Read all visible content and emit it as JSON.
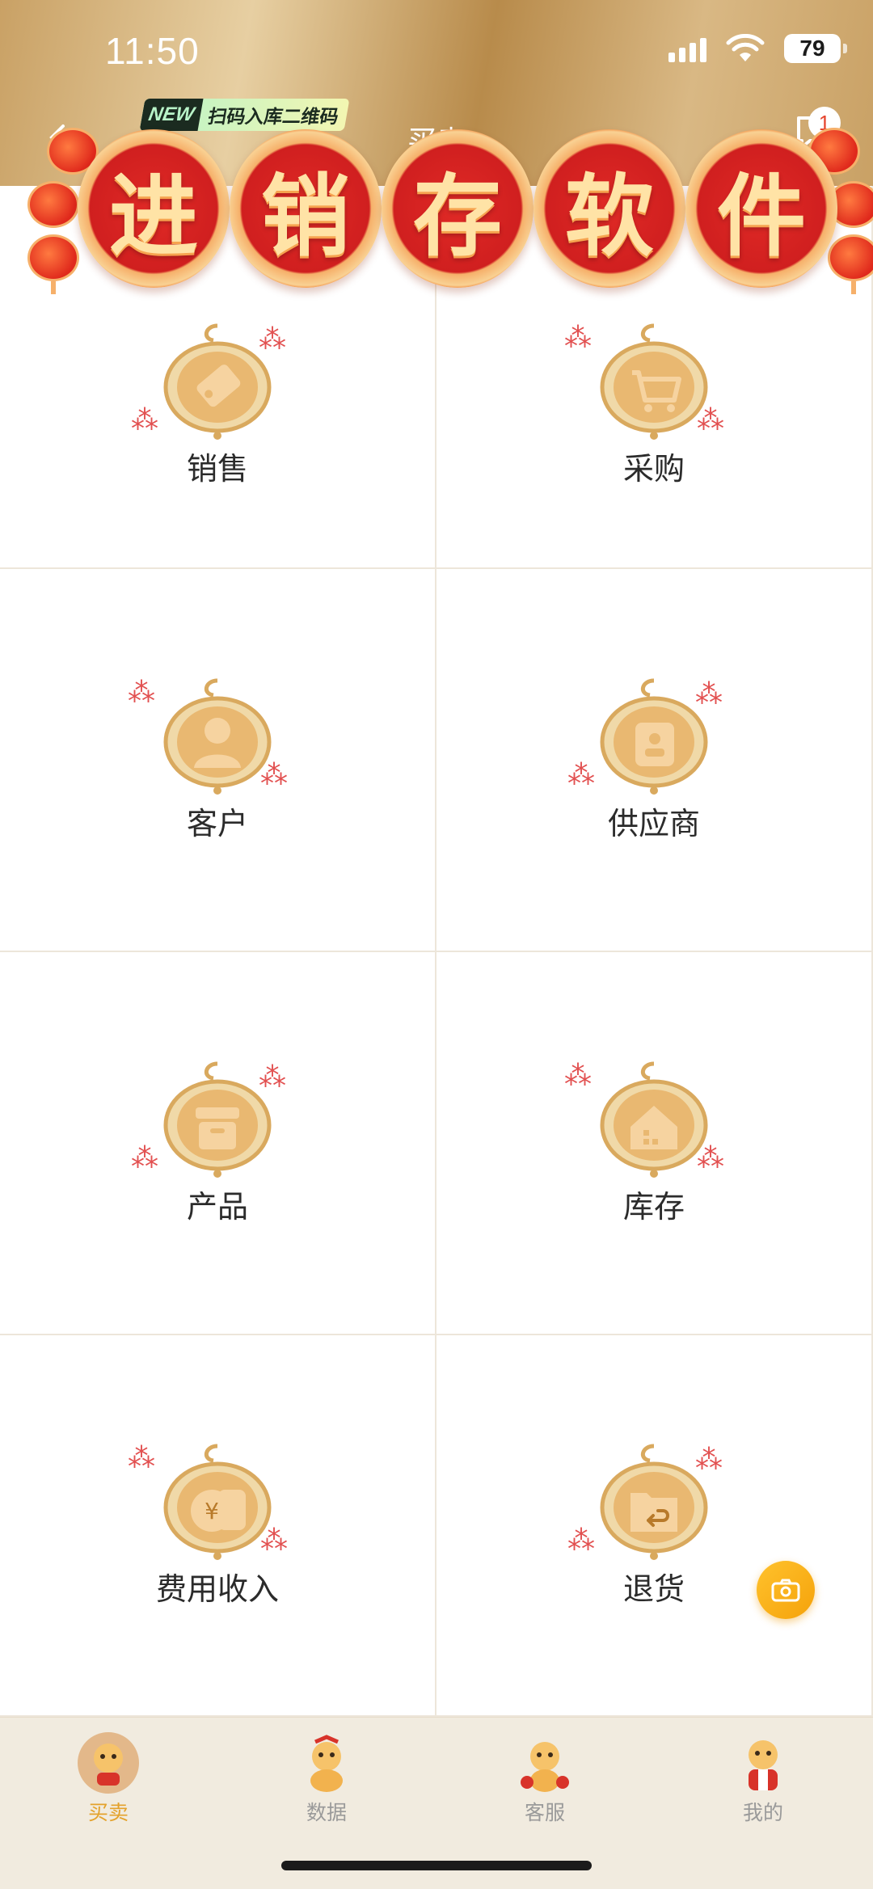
{
  "status_bar": {
    "time": "11:50",
    "battery": "79"
  },
  "header": {
    "title": "买卖",
    "new_tag": "NEW",
    "new_tag_text": "扫码入库二维码",
    "message_badge": "1"
  },
  "banner": {
    "chars": [
      "进",
      "销",
      "存",
      "软",
      "件"
    ]
  },
  "menu": {
    "sales": "销售",
    "purchase": "采购",
    "customer": "客户",
    "supplier": "供应商",
    "product": "产品",
    "inventory": "库存",
    "expense_income": "费用收入",
    "returns": "退货"
  },
  "tabbar": {
    "trade": "买卖",
    "data": "数据",
    "service": "客服",
    "mine": "我的",
    "active": "买卖"
  },
  "colors": {
    "accent": "#e4a22c",
    "gold": "#d9a95e",
    "banner_red": "#d01f1f"
  }
}
